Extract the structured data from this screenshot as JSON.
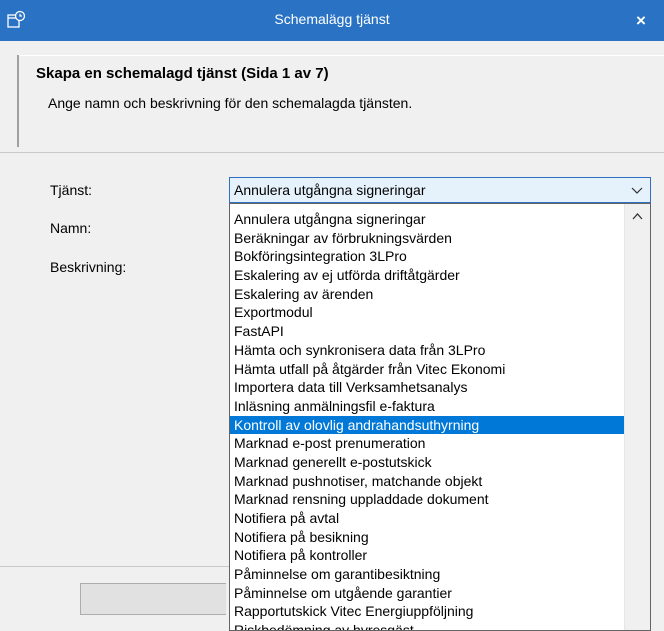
{
  "window": {
    "title": "Schemalägg tjänst",
    "app_icon": "scheduled-task-icon",
    "close_icon": "close-icon",
    "close_glyph": "×"
  },
  "header": {
    "title": "Skapa en schemalagd tjänst (Sida 1 av 7)",
    "subtitle": "Ange namn och beskrivning för den schemalagda tjänsten."
  },
  "form": {
    "tjanst_label": "Tjänst:",
    "namn_label": "Namn:",
    "beskrivning_label": "Beskrivning:",
    "selected_service": "Annulera utgångna signeringar"
  },
  "dropdown": {
    "highlighted_index": 11,
    "items": [
      "Annulera utgångna signeringar",
      "Beräkningar av förbrukningsvärden",
      "Bokföringsintegration 3LPro",
      "Eskalering av ej utförda driftåtgärder",
      "Eskalering av ärenden",
      "Exportmodul",
      "FastAPI",
      "Hämta och synkronisera data från 3LPro",
      "Hämta utfall på åtgärder från Vitec Ekonomi",
      "Importera data till Verksamhetsanalys",
      "Inläsning anmälningsfil e-faktura",
      "Kontroll av olovlig andrahandsuthyrning",
      "Marknad e-post prenumeration",
      "Marknad generellt e-postutskick",
      "Marknad pushnotiser, matchande objekt",
      "Marknad rensning uppladdade dokument",
      "Notifiera på avtal",
      "Notifiera på besikning",
      "Notifiera på kontroller",
      "Påminnelse om garantibesiktning",
      "Påminnelse om utgående garantier",
      "Rapportutskick Vitec Energiuppföljning",
      "Riskbedömning av hyresgäst"
    ]
  },
  "colors": {
    "titlebar": "#2a73c4",
    "selection": "#0078d7",
    "combo_border": "#2f6fc0",
    "combo_fill": "#e5f1fb"
  }
}
